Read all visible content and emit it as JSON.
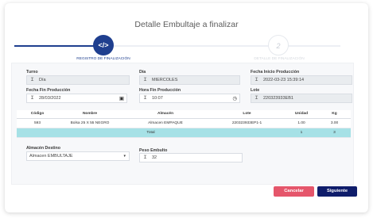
{
  "dialog": {
    "title": "Detalle Embultaje a finalizar"
  },
  "stepper": {
    "steps": [
      {
        "number": "</>",
        "label": "REGISTRO DE FINALIZACIÓN",
        "state": "active"
      },
      {
        "number": "2",
        "label": "DETALLE DE FINALIZACIÓN",
        "state": "inactive"
      }
    ]
  },
  "form": {
    "turno": {
      "label": "Turno",
      "value": "Día"
    },
    "dia": {
      "label": "Día",
      "value": "MIERCOLES"
    },
    "fecha_inicio": {
      "label": "Fecha Inicio Producción",
      "value": "2022-03-23 15:39:14"
    },
    "fecha_fin": {
      "label": "Fecha Fin Producción",
      "value": "28/03/2022"
    },
    "hora_fin": {
      "label": "Hora Fin Producción",
      "value": "10:07"
    },
    "lote": {
      "label": "Lote",
      "value": "220323933EB1"
    },
    "almacen_destino": {
      "label": "Almacén Destino",
      "value": "Almacen EMBULTAJE"
    },
    "peso_embulto": {
      "label": "Peso Embulto",
      "value": "32"
    }
  },
  "table": {
    "headers": [
      "Código",
      "Nombre",
      "Almacén",
      "Lote",
      "Unidad",
      "Kg"
    ],
    "rows": [
      [
        "593",
        "Bolsa 25 X 55 NEGRO",
        "Almacen EMPAQUE",
        "220323933EP1-1",
        "1.00",
        "3.00"
      ]
    ],
    "total": {
      "label": "Total",
      "unidad": "1",
      "kg": "3"
    }
  },
  "buttons": {
    "cancel": "Cancelar",
    "next": "Siguiente"
  },
  "colors": {
    "primary": "#1f3f8f",
    "navy": "#0f1d6b",
    "danger": "#e5566b",
    "total_row": "#a6e1e6"
  }
}
